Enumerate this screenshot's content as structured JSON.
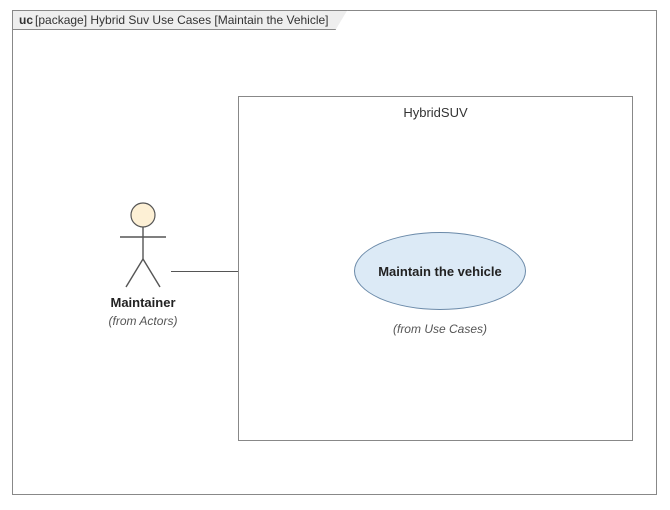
{
  "frame": {
    "kind": "uc",
    "title": "[package] Hybrid Suv Use Cases [Maintain the Vehicle]"
  },
  "system": {
    "name": "HybridSUV"
  },
  "actor": {
    "name": "Maintainer",
    "from": "(from Actors)"
  },
  "usecase": {
    "name": "Maintain the vehicle",
    "from": "(from Use Cases)"
  },
  "chart_data": {
    "type": "uml-use-case",
    "frame": "uc [package] Hybrid Suv Use Cases [Maintain the Vehicle]",
    "system_boundary": "HybridSUV",
    "actors": [
      {
        "name": "Maintainer",
        "package": "Actors"
      }
    ],
    "use_cases": [
      {
        "name": "Maintain the vehicle",
        "package": "Use Cases",
        "boundary": "HybridSUV"
      }
    ],
    "associations": [
      {
        "actor": "Maintainer",
        "use_case": "Maintain the vehicle"
      }
    ]
  }
}
